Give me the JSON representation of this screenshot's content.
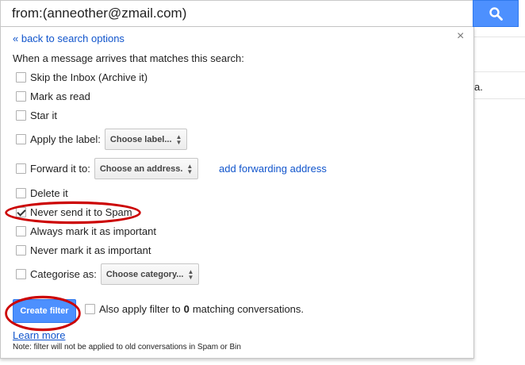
{
  "search": {
    "query": "from:(anneother@zmail.com)"
  },
  "background": {
    "snippet": "a."
  },
  "panel": {
    "back_link": "« back to search options",
    "close": "×",
    "intro": "When a message arrives that matches this search:",
    "options": [
      {
        "label": "Skip the Inbox (Archive it)",
        "checked": false
      },
      {
        "label": "Mark as read",
        "checked": false
      },
      {
        "label": "Star it",
        "checked": false
      },
      {
        "label": "Apply the label:",
        "checked": false,
        "select": "Choose label..."
      },
      {
        "label": "Forward it to:",
        "checked": false,
        "select": "Choose an address."
      },
      {
        "label": "Delete it",
        "checked": false
      },
      {
        "label": "Never send it to Spam",
        "checked": true
      },
      {
        "label": "Always mark it as important",
        "checked": false
      },
      {
        "label": "Never mark it as important",
        "checked": false
      },
      {
        "label": "Categorise as:",
        "checked": false,
        "select": "Choose category..."
      }
    ],
    "forward_link": "add forwarding address",
    "create_button": "Create filter",
    "also_apply": {
      "prefix": "Also apply filter to",
      "count": "0",
      "suffix": "matching conversations.",
      "checked": false
    },
    "learn_more": "Learn more",
    "note": "Note: filter will not be applied to old conversations in Spam or Bin"
  },
  "colors": {
    "accent": "#4d90fe",
    "link": "#1155cc",
    "annotation": "#cc0000"
  },
  "icons": {
    "search": "search-icon",
    "close": "close-icon",
    "dropdown": "updown-arrows-icon"
  }
}
